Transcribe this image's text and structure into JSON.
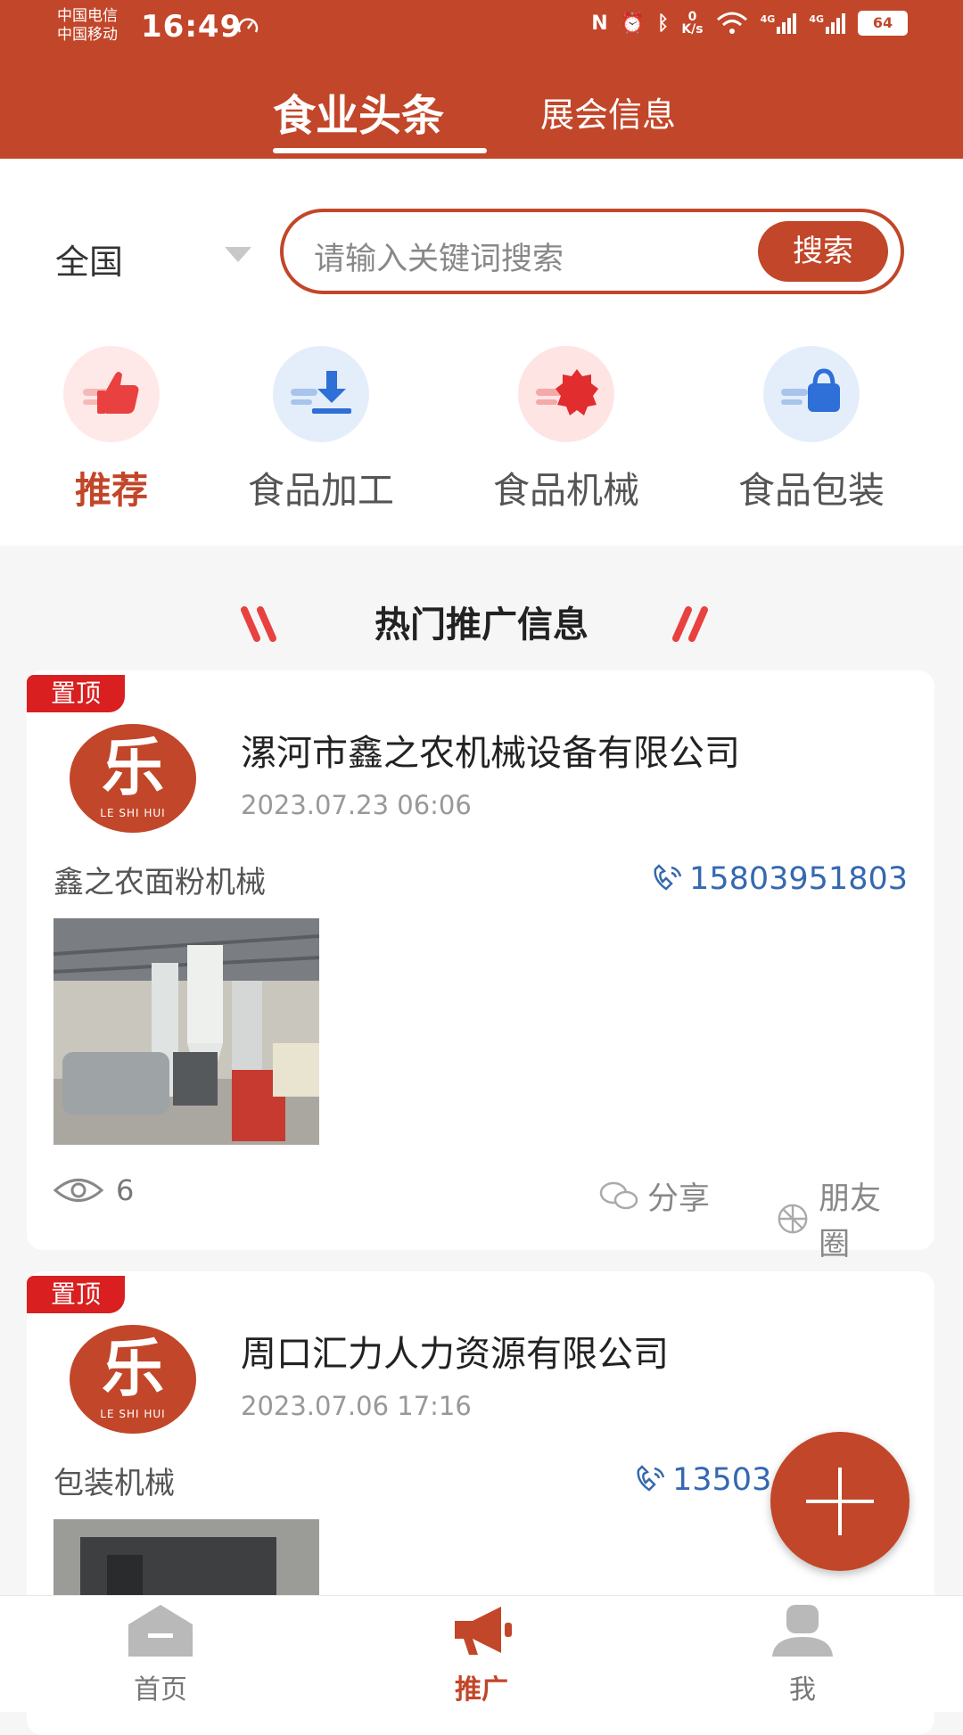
{
  "status_bar": {
    "carrier_1": "中国电信",
    "carrier_2": "中国移动",
    "time": "16:49",
    "net_speed_value": "0",
    "net_speed_unit": "K/s",
    "signal_1_label": "4G",
    "signal_2_label": "4G",
    "battery": "64"
  },
  "top_tabs": {
    "active": "食业头条",
    "other": "展会信息"
  },
  "filter": {
    "region": "全国",
    "search_placeholder": "请输入关键词搜索",
    "search_button": "搜索"
  },
  "categories": [
    {
      "label": "推荐",
      "icon": "thumbs-up-icon",
      "active": true
    },
    {
      "label": "食品加工",
      "icon": "download-icon",
      "active": false
    },
    {
      "label": "食品机械",
      "icon": "gear-icon",
      "active": false
    },
    {
      "label": "食品包装",
      "icon": "bag-icon",
      "active": false
    }
  ],
  "section_title": "热门推广信息",
  "posts": [
    {
      "badge": "置顶",
      "avatar_char": "乐",
      "avatar_sub": "LE SHI HUI",
      "company": "漯河市鑫之农机械设备有限公司",
      "date": "2023.07.23 06:06",
      "product": "鑫之农面粉机械",
      "phone": "15803951803",
      "views": "6",
      "share_label": "分享",
      "moments_label": "朋友圈"
    },
    {
      "badge": "置顶",
      "avatar_char": "乐",
      "avatar_sub": "LE SHI HUI",
      "company": "周口汇力人力资源有限公司",
      "date": "2023.07.06 17:16",
      "product": "包装机械",
      "phone": "13503"
    }
  ],
  "bottom_nav": [
    {
      "label": "首页",
      "icon": "home-icon",
      "active": false
    },
    {
      "label": "推广",
      "icon": "megaphone-icon",
      "active": true
    },
    {
      "label": "我",
      "icon": "user-icon",
      "active": false
    }
  ],
  "colors": {
    "primary": "#c24629",
    "badge": "#d91f1f",
    "phone": "#3568b0"
  }
}
